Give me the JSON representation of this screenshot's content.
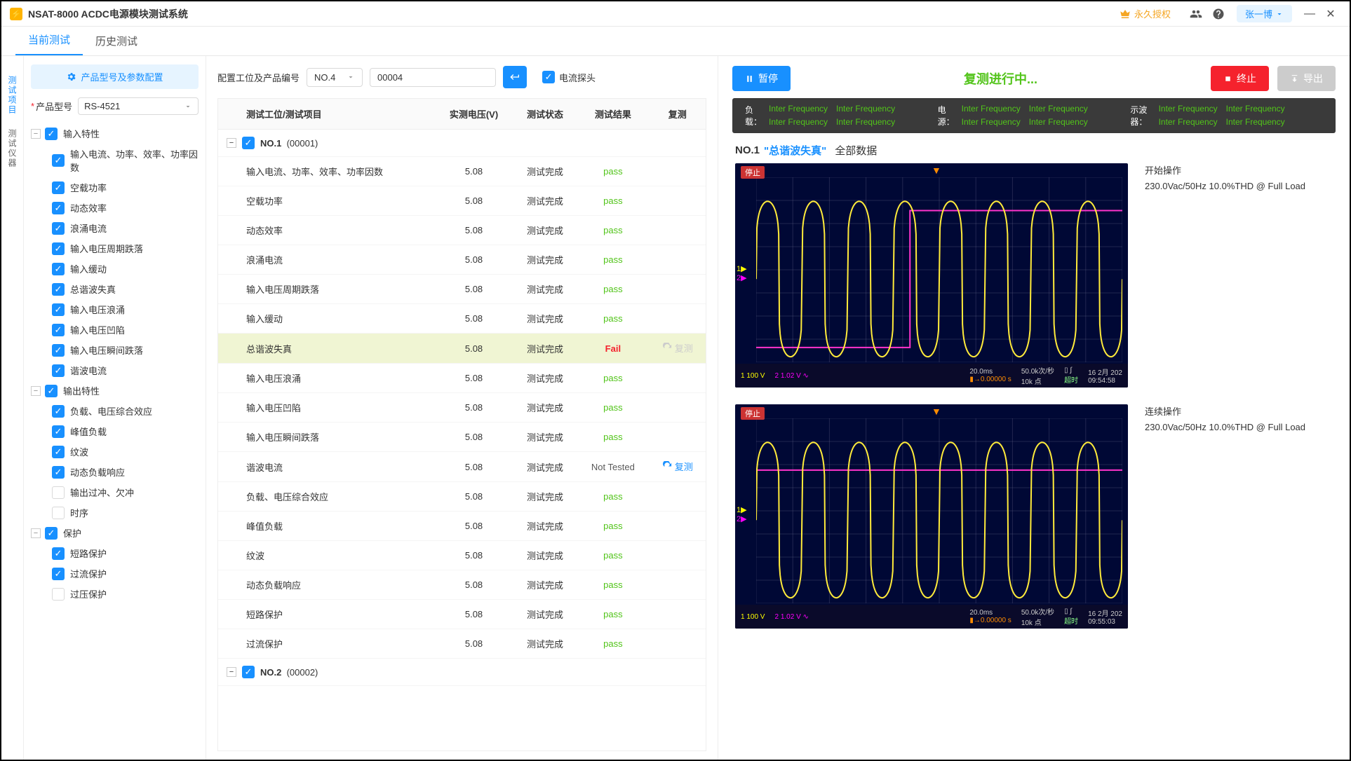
{
  "window": {
    "title": "NSAT-8000 ACDC电源模块测试系统",
    "license_badge": "永久授权",
    "user_name": "张一博"
  },
  "tabs": {
    "current": "当前测试",
    "history": "历史测试"
  },
  "side_rail": {
    "project": "测试项目",
    "instrument": "测试仪器"
  },
  "tree": {
    "config_btn": "产品型号及参数配置",
    "model_label": "产品型号",
    "model_value": "RS-4521",
    "groups": [
      {
        "name": "输入特性",
        "checked": true,
        "items": [
          {
            "label": "输入电流、功率、效率、功率因数",
            "checked": true
          },
          {
            "label": "空载功率",
            "checked": true
          },
          {
            "label": "动态效率",
            "checked": true
          },
          {
            "label": "浪涌电流",
            "checked": true
          },
          {
            "label": "输入电压周期跌落",
            "checked": true
          },
          {
            "label": "输入缓动",
            "checked": true
          },
          {
            "label": "总谐波失真",
            "checked": true
          },
          {
            "label": "输入电压浪涌",
            "checked": true
          },
          {
            "label": "输入电压凹陷",
            "checked": true
          },
          {
            "label": "输入电压瞬间跌落",
            "checked": true
          },
          {
            "label": "谐波电流",
            "checked": true
          }
        ]
      },
      {
        "name": "输出特性",
        "checked": true,
        "items": [
          {
            "label": "负载、电压综合效应",
            "checked": true
          },
          {
            "label": "峰值负载",
            "checked": true
          },
          {
            "label": "纹波",
            "checked": true
          },
          {
            "label": "动态负载响应",
            "checked": true
          },
          {
            "label": "输出过冲、欠冲",
            "checked": false
          },
          {
            "label": "时序",
            "checked": false
          }
        ]
      },
      {
        "name": "保护",
        "checked": true,
        "items": [
          {
            "label": "短路保护",
            "checked": true
          },
          {
            "label": "过流保护",
            "checked": true
          },
          {
            "label": "过压保护",
            "checked": false
          }
        ]
      }
    ]
  },
  "center_head": {
    "label": "配置工位及产品编号",
    "station_value": "NO.4",
    "serial_value": "00004",
    "probe_label": "电流探头"
  },
  "table": {
    "columns": [
      "测试工位/测试项目",
      "实测电压(V)",
      "测试状态",
      "测试结果",
      "复测"
    ],
    "groups": [
      {
        "title": "NO.1",
        "serial": "(00001)"
      },
      {
        "title": "NO.2",
        "serial": "(00002)"
      }
    ],
    "rows": [
      {
        "name": "输入电流、功率、效率、功率因数",
        "v": "5.08",
        "state": "测试完成",
        "result": "pass"
      },
      {
        "name": "空载功率",
        "v": "5.08",
        "state": "测试完成",
        "result": "pass"
      },
      {
        "name": "动态效率",
        "v": "5.08",
        "state": "测试完成",
        "result": "pass"
      },
      {
        "name": "浪涌电流",
        "v": "5.08",
        "state": "测试完成",
        "result": "pass"
      },
      {
        "name": "输入电压周期跌落",
        "v": "5.08",
        "state": "测试完成",
        "result": "pass"
      },
      {
        "name": "输入缓动",
        "v": "5.08",
        "state": "测试完成",
        "result": "pass"
      },
      {
        "name": "总谐波失真",
        "v": "5.08",
        "state": "测试完成",
        "result": "Fail",
        "highlight": true,
        "retest": "disabled"
      },
      {
        "name": "输入电压浪涌",
        "v": "5.08",
        "state": "测试完成",
        "result": "pass"
      },
      {
        "name": "输入电压凹陷",
        "v": "5.08",
        "state": "测试完成",
        "result": "pass"
      },
      {
        "name": "输入电压瞬间跌落",
        "v": "5.08",
        "state": "测试完成",
        "result": "pass"
      },
      {
        "name": "谐波电流",
        "v": "5.08",
        "state": "测试完成",
        "result": "Not Tested",
        "retest": "enabled"
      },
      {
        "name": "负载、电压综合效应",
        "v": "5.08",
        "state": "测试完成",
        "result": "pass"
      },
      {
        "name": "峰值负载",
        "v": "5.08",
        "state": "测试完成",
        "result": "pass"
      },
      {
        "name": "纹波",
        "v": "5.08",
        "state": "测试完成",
        "result": "pass"
      },
      {
        "name": "动态负载响应",
        "v": "5.08",
        "state": "测试完成",
        "result": "pass"
      },
      {
        "name": "短路保护",
        "v": "5.08",
        "state": "测试完成",
        "result": "pass"
      },
      {
        "name": "过流保护",
        "v": "5.08",
        "state": "测试完成",
        "result": "pass"
      }
    ],
    "retest_label": "复测"
  },
  "right": {
    "pause_btn": "暂停",
    "status": "复测进行中...",
    "stop_btn": "终止",
    "export_btn": "导出",
    "instruments": {
      "load_k": "负载：",
      "power_k": "电源：",
      "scope_k": "示波器：",
      "val": "Inter Frequency"
    },
    "detail": {
      "no": "NO.1",
      "test_name": "\"总谐波失真\"",
      "all": "全部数据"
    },
    "scopes": [
      {
        "op": "开始操作",
        "cond": "230.0Vac/50Hz 10.0%THD @ Full Load",
        "ts": "09:54:58"
      },
      {
        "op": "连续操作",
        "cond": "230.0Vac/50Hz 10.0%THD @ Full Load",
        "ts": "09:55:03"
      }
    ],
    "scope_bottom": {
      "ch1": "100 V",
      "ch2": "1.02 V",
      "time": "20.0ms",
      "offset": "0.00000 s",
      "rate": "50.0k次/秒",
      "pts": "10k 点",
      "date": "16 2月 202"
    },
    "scope_stop": "停止"
  }
}
